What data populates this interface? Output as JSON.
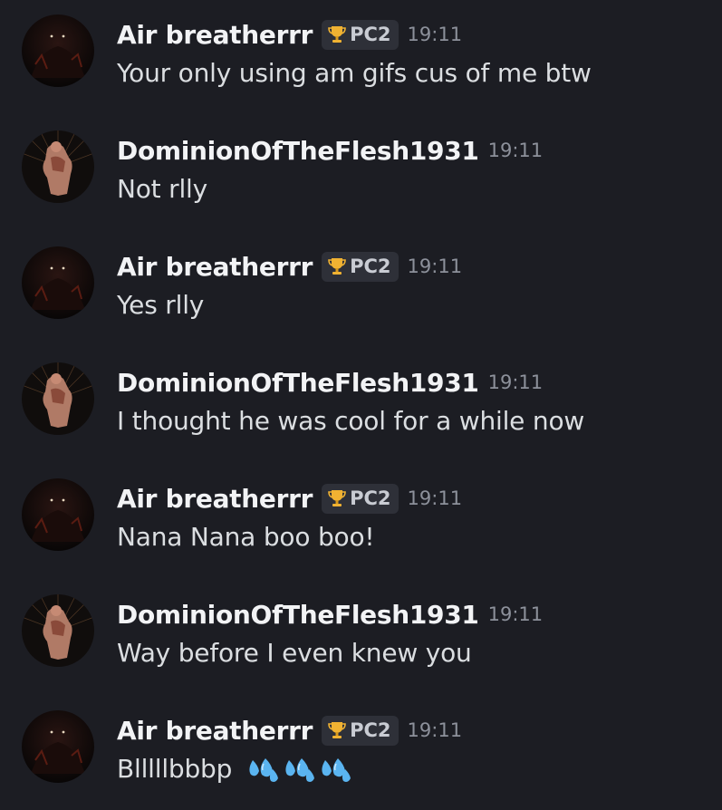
{
  "messages": [
    {
      "author": "Air breatherrr",
      "tag": "PC2",
      "time": "19:11",
      "text": "Your only using am gifs cus of me btw"
    },
    {
      "author": "DominionOfTheFlesh1931",
      "time": "19:11",
      "text": "Not rlly"
    },
    {
      "author": "Air breatherrr",
      "tag": "PC2",
      "time": "19:11",
      "text": "Yes rlly"
    },
    {
      "author": "DominionOfTheFlesh1931",
      "time": "19:11",
      "text": "I thought he was cool for a while now"
    },
    {
      "author": "Air breatherrr",
      "tag": "PC2",
      "time": "19:11",
      "text": "Nana Nana boo boo!"
    },
    {
      "author": "DominionOfTheFlesh1931",
      "time": "19:11",
      "text": "Way before I even knew you"
    },
    {
      "author": "Air breatherrr",
      "tag": "PC2",
      "time": "19:11",
      "text": "Blllllbbbp",
      "emoji": [
        "sweat-droplets-emoji",
        "sweat-droplets-emoji",
        "sweat-droplets-emoji"
      ]
    }
  ],
  "icons": {
    "tag_icon": "trophy-icon",
    "avatar_air": "dark-creature-avatar",
    "avatar_dominion": "flesh-figure-avatar"
  },
  "colors": {
    "background": "#1c1d23",
    "username": "#f2f3f5",
    "message_text": "#dbdee1",
    "timestamp": "#8d919b",
    "tag_bg": "#2e3038",
    "trophy": "#f0b232",
    "droplets": "#5ab4f0"
  }
}
